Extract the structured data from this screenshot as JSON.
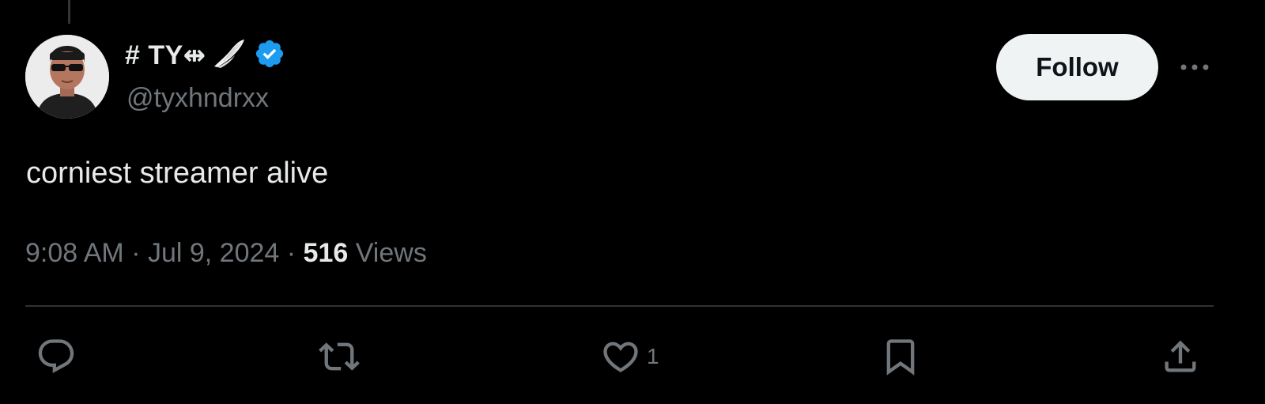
{
  "tweet": {
    "author": {
      "display_name": "# TY⇹",
      "handle": "@tyxhndrxx",
      "verified": true,
      "avatar_icon": "cartoon-avatar-sunglasses"
    },
    "follow_label": "Follow",
    "more_icon": "more-horizontal-icon",
    "text": "corniest streamer alive",
    "meta": {
      "time": "9:08 AM",
      "separator": " · ",
      "date": "Jul 9, 2024",
      "views_count": "516",
      "views_label": "Views"
    },
    "actions": {
      "reply": {
        "icon": "reply-icon"
      },
      "retweet": {
        "icon": "retweet-icon"
      },
      "like": {
        "icon": "heart-icon",
        "count": "1"
      },
      "bookmark": {
        "icon": "bookmark-icon"
      },
      "share": {
        "icon": "share-icon"
      }
    }
  },
  "colors": {
    "background": "#000000",
    "text_primary": "#e7e9ea",
    "text_secondary": "#71767b",
    "verified_blue": "#1d9bf0",
    "divider": "#2f3336",
    "follow_bg": "#eff3f4",
    "follow_text": "#0f1419"
  }
}
